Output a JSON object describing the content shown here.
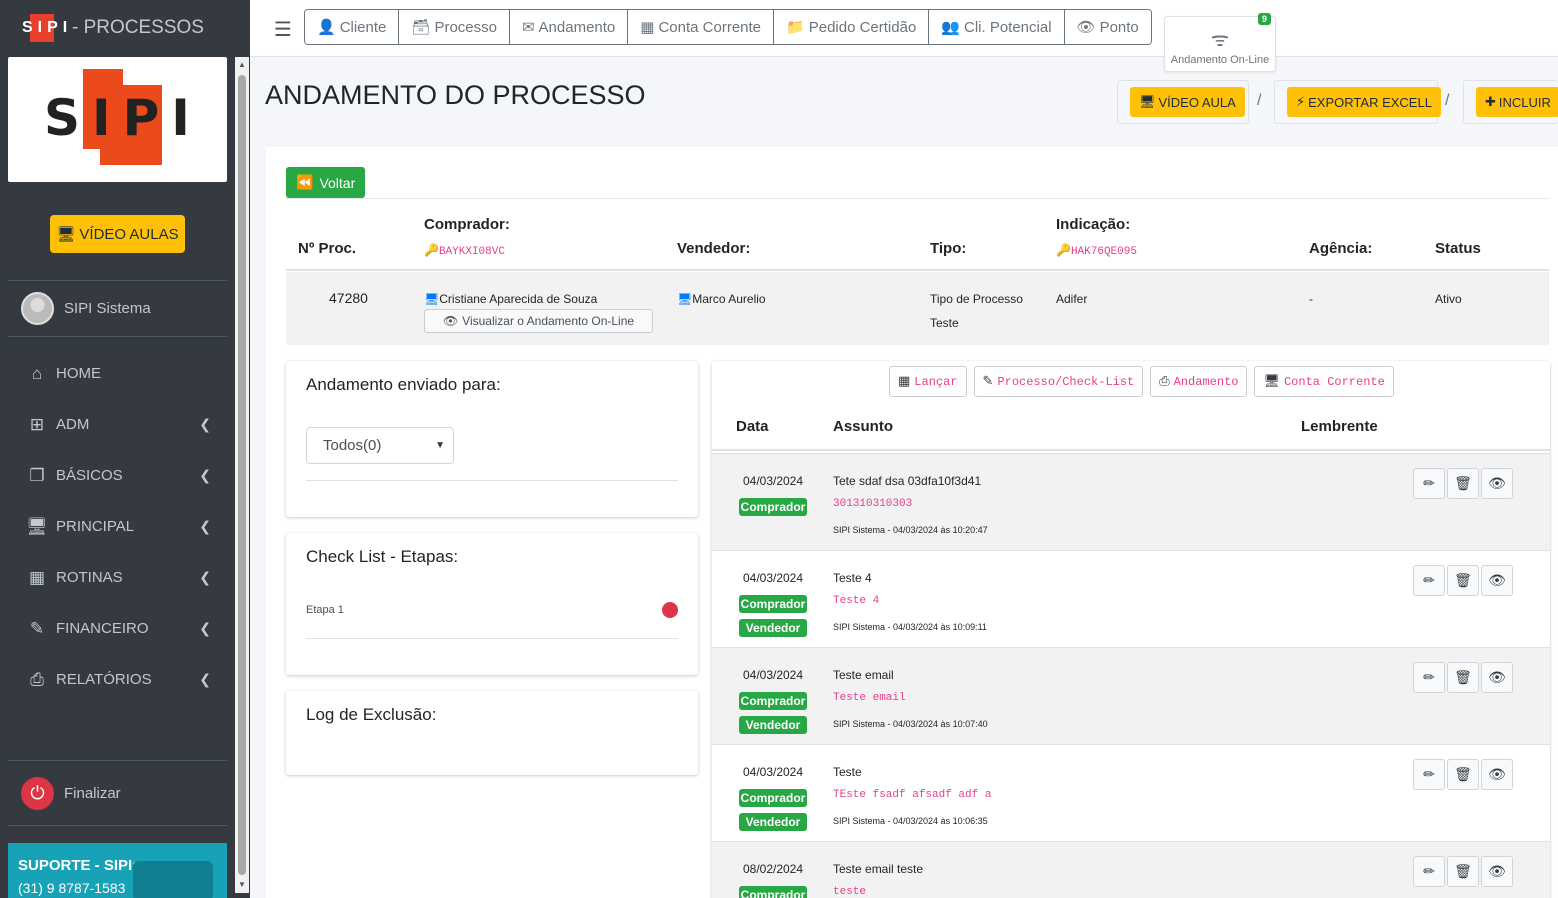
{
  "brand": {
    "logo_text": "SIPI",
    "suffix": "- PROCESSOS"
  },
  "sidebar": {
    "video_aulas": "VÍDEO AULAS",
    "user_name": "SIPI Sistema",
    "items": [
      {
        "label": "HOME",
        "icon": "home-icon"
      },
      {
        "label": "ADM",
        "icon": "sitemap-icon"
      },
      {
        "label": "BÁSICOS",
        "icon": "copy-icon"
      },
      {
        "label": "PRINCIPAL",
        "icon": "desktop-icon"
      },
      {
        "label": "ROTINAS",
        "icon": "table-icon"
      },
      {
        "label": "FINANCEIRO",
        "icon": "edit-icon"
      },
      {
        "label": "RELATÓRIOS",
        "icon": "print-icon"
      }
    ],
    "finalizar": "Finalizar",
    "suporte_title": "SUPORTE - SIPI:",
    "suporte_phone": "(31) 9 8787-1583"
  },
  "topbar": {
    "buttons": [
      "Cliente",
      "Processo",
      "Andamento",
      "Conta Corrente",
      "Pedido Certidão",
      "Cli. Potencial",
      "Ponto"
    ],
    "online_label": "Andamento On-Line",
    "online_count": "9"
  },
  "header": {
    "title": "ANDAMENTO DO PROCESSO",
    "video_aula": "VÍDEO AULA",
    "exportar": "EXPORTAR EXCELL",
    "incluir": "INCLUIR",
    "sep": "/"
  },
  "voltar": "Voltar",
  "process": {
    "headers": {
      "num": "Nº Proc.",
      "comprador": "Comprador:",
      "comprador_code": "BAYKXI08VC",
      "vendedor": "Vendedor:",
      "tipo": "Tipo:",
      "indicacao": "Indicação:",
      "indicacao_code": "HAK76QE095",
      "agencia": "Agência:",
      "status": "Status"
    },
    "row": {
      "num": "47280",
      "comprador": "Cristiane Aparecida de Souza",
      "visualizar": "Visualizar o Andamento On-Line",
      "vendedor": "Marco Aurelio",
      "tipo_l1": "Tipo de Processo",
      "tipo_l2": "Teste",
      "indicacao": "Adifer",
      "agencia": "-",
      "status": "Ativo"
    }
  },
  "left": {
    "enviado_title": "Andamento enviado para:",
    "select_value": "Todos(0)",
    "checklist_title": "Check List - Etapas:",
    "etapa": "Etapa 1",
    "log_title": "Log de Exclusão:"
  },
  "right": {
    "actions": [
      "Lançar",
      "Processo/Check-List",
      "Andamento",
      "Conta Corrente"
    ],
    "headers": {
      "data": "Data",
      "assunto": "Assunto",
      "lembrente": "Lembrente"
    },
    "rows": [
      {
        "date": "04/03/2024",
        "badges": [
          "Comprador"
        ],
        "subject": "Tete sdaf dsa 03dfa10f3d41",
        "sub": "301310310303",
        "meta": "SIPI Sistema - 04/03/2024 às 10:20:47"
      },
      {
        "date": "04/03/2024",
        "badges": [
          "Comprador",
          "Vendedor"
        ],
        "subject": "Teste 4",
        "sub": "Teste 4",
        "meta": "SIPI Sistema - 04/03/2024 às 10:09:11"
      },
      {
        "date": "04/03/2024",
        "badges": [
          "Comprador",
          "Vendedor"
        ],
        "subject": "Teste email",
        "sub": "Teste email",
        "meta": "SIPI Sistema - 04/03/2024 às 10:07:40"
      },
      {
        "date": "04/03/2024",
        "badges": [
          "Comprador",
          "Vendedor"
        ],
        "subject": "Teste",
        "sub": "TEste fsadf afsadf adf a",
        "meta": "SIPI Sistema - 04/03/2024 às 10:06:35"
      },
      {
        "date": "08/02/2024",
        "badges": [
          "Comprador"
        ],
        "subject": "Teste email teste",
        "sub": "teste",
        "meta": ""
      }
    ]
  },
  "colors": {
    "sidebar": "#343a40",
    "yellow": "#ffc107",
    "green": "#28a745",
    "pink": "#e83e8c",
    "red": "#dc3545"
  }
}
